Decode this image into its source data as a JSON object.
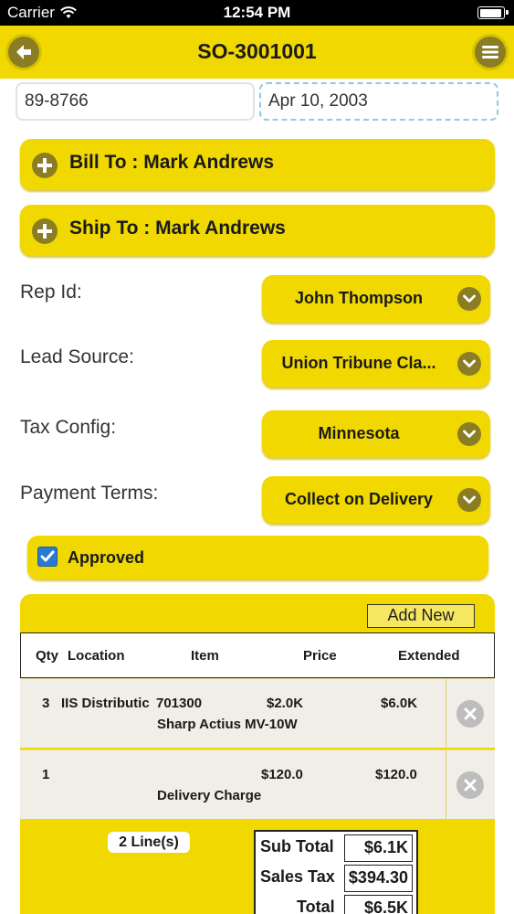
{
  "status_bar": {
    "carrier": "Carrier",
    "time": "12:54 PM"
  },
  "nav": {
    "title": "SO-3001001",
    "back_icon": "back-arrow-icon",
    "menu_icon": "menu-icon"
  },
  "order": {
    "customer_code": "89-8766",
    "date": "Apr 10, 2003"
  },
  "bill_to": {
    "label": "Bill To : Mark Andrews"
  },
  "ship_to": {
    "label": "Ship To : Mark Andrews"
  },
  "form": {
    "rep_id": {
      "label": "Rep Id:",
      "value": "John Thompson"
    },
    "lead_source": {
      "label": "Lead Source:",
      "value": "Union Tribune Cla..."
    },
    "tax_config": {
      "label": "Tax Config:",
      "value": "Minnesota"
    },
    "payment_terms": {
      "label": "Payment Terms:",
      "value": "Collect on Delivery"
    }
  },
  "approved": {
    "label": "Approved",
    "checked": true
  },
  "grid": {
    "add_new": "Add New",
    "columns": {
      "qty": "Qty",
      "location": "Location",
      "item": "Item",
      "price": "Price",
      "extended": "Extended"
    },
    "rows": [
      {
        "qty": "3",
        "location": "IIS Distributic",
        "item": "701300",
        "price": "$2.0K",
        "extended": "$6.0K",
        "description": "Sharp Actius MV-10W"
      },
      {
        "qty": "1",
        "location": "",
        "item": "",
        "price": "$120.0",
        "extended": "$120.0",
        "description": "Delivery Charge"
      }
    ],
    "line_count": "2 Line(s)"
  },
  "totals": {
    "sub_total_label": "Sub Total",
    "sub_total": "$6.1K",
    "sales_tax_label": "Sales Tax",
    "sales_tax": "$394.30",
    "total_label": "Total",
    "total": "$6.5K"
  },
  "colors": {
    "accent": "#f0d800",
    "icon_dark": "#8a7d24",
    "checkbox": "#2a7ad2"
  }
}
